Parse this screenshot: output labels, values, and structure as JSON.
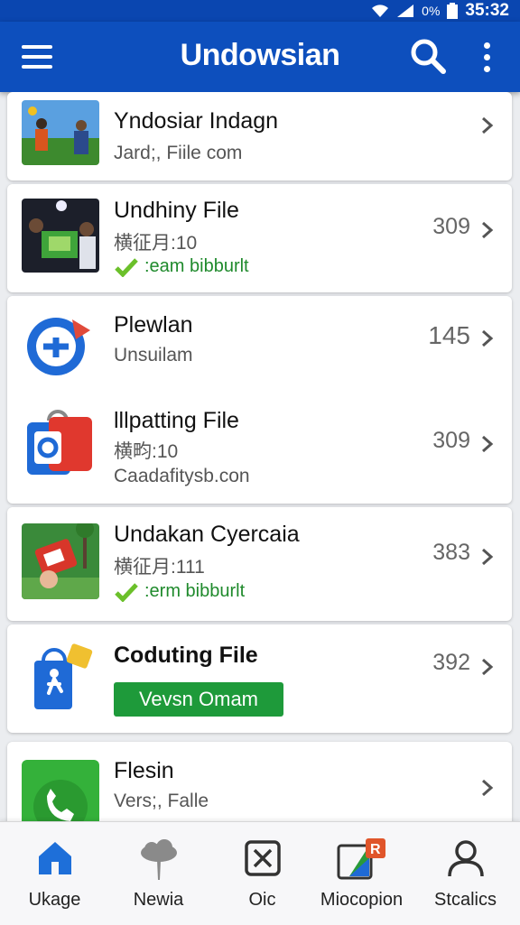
{
  "status_bar": {
    "battery": "0%",
    "time": "35:32"
  },
  "app_bar": {
    "title": "Undowsian"
  },
  "items": [
    {
      "title": "Yndosiar Indagn",
      "subtitle": "Jard;, Fiile com",
      "count": ""
    },
    {
      "title": "Undhiny File",
      "meta": "横征月:10",
      "badge": ":eam bibburlt",
      "count": "309"
    },
    {
      "title": "Plewlan",
      "subtitle": "Unsuilam",
      "count": "145"
    },
    {
      "title": "lllpatting File",
      "meta": "横畇:10",
      "subtitle": "Caadafitysb.con",
      "count": "309"
    },
    {
      "title": "Undakan Cyercaia",
      "meta": "横征月:111",
      "badge": ":erm bibburlt",
      "count": "383"
    },
    {
      "title": "Coduting File",
      "button": "Vevsn Omam",
      "count": "392"
    },
    {
      "title": "Flesin",
      "subtitle": "Vers;, Falle",
      "count": ""
    }
  ],
  "bottom_nav": [
    {
      "label": "Ukage",
      "icon": "home-icon",
      "color": "#1e6fd9"
    },
    {
      "label": "Newia",
      "icon": "tree-icon",
      "color": "#777777"
    },
    {
      "label": "Oic",
      "icon": "close-box-icon",
      "color": "#333333"
    },
    {
      "label": "Miocopion",
      "icon": "store-icon",
      "color": "#e0552a"
    },
    {
      "label": "Stcalics",
      "icon": "person-icon",
      "color": "#333333"
    }
  ],
  "colors": {
    "primary": "#0d4fbd",
    "accent_green": "#1e9a3a"
  }
}
